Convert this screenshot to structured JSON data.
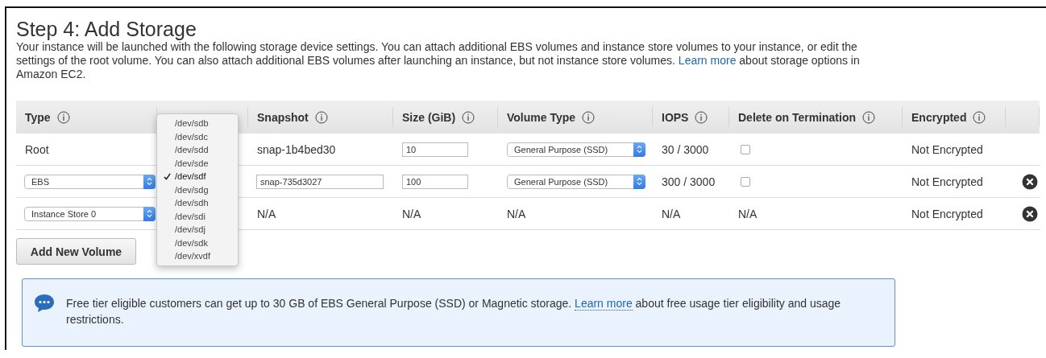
{
  "title": "Step 4: Add Storage",
  "description": {
    "before": "Your instance will be launched with the following storage device settings. You can attach additional EBS volumes and instance store volumes to your instance, or edit the settings of the root volume. You can also attach additional EBS volumes after launching an instance, but not instance store volumes.",
    "link": "Learn more",
    "after": "about storage options in Amazon EC2."
  },
  "table": {
    "columns": [
      "Type",
      "Snapshot",
      "Size (GiB)",
      "Volume Type",
      "IOPS",
      "Delete on Termination",
      "Encrypted"
    ],
    "rows": [
      {
        "type": {
          "kind": "text",
          "value": "Root"
        },
        "snapshot": {
          "kind": "text",
          "value": "snap-1b4bed30"
        },
        "size": {
          "kind": "input",
          "value": "10"
        },
        "volume_type": {
          "kind": "select",
          "value": "General Purpose (SSD)"
        },
        "iops": "30 / 3000",
        "delete_on_termination": {
          "kind": "checkbox",
          "checked": false
        },
        "encrypted": "Not Encrypted",
        "removable": false
      },
      {
        "type": {
          "kind": "select",
          "value": "EBS"
        },
        "snapshot": {
          "kind": "input",
          "value": "snap-735d3027"
        },
        "size": {
          "kind": "input",
          "value": "100"
        },
        "volume_type": {
          "kind": "select",
          "value": "General Purpose (SSD)"
        },
        "iops": "300 / 3000",
        "delete_on_termination": {
          "kind": "checkbox",
          "checked": false
        },
        "encrypted": "Not Encrypted",
        "removable": true
      },
      {
        "type": {
          "kind": "select",
          "value": "Instance Store 0"
        },
        "snapshot": {
          "kind": "text",
          "value": "N/A"
        },
        "size": {
          "kind": "text",
          "value": "N/A"
        },
        "volume_type": {
          "kind": "text",
          "value": "N/A"
        },
        "iops": "N/A",
        "delete_on_termination": {
          "kind": "text",
          "value": "N/A"
        },
        "encrypted": "Not Encrypted",
        "removable": true
      }
    ]
  },
  "device_menu": [
    {
      "label": "/dev/sdb",
      "selected": false
    },
    {
      "label": "/dev/sdc",
      "selected": false
    },
    {
      "label": "/dev/sdd",
      "selected": false
    },
    {
      "label": "/dev/sde",
      "selected": false
    },
    {
      "label": "/dev/sdf",
      "selected": true
    },
    {
      "label": "/dev/sdg",
      "selected": false
    },
    {
      "label": "/dev/sdh",
      "selected": false
    },
    {
      "label": "/dev/sdi",
      "selected": false
    },
    {
      "label": "/dev/sdj",
      "selected": false
    },
    {
      "label": "/dev/sdk",
      "selected": false
    },
    {
      "label": "/dev/xvdf",
      "selected": false
    }
  ],
  "add_button": "Add New Volume",
  "notice": {
    "before": "Free tier eligible customers can get up to 30 GB of EBS General Purpose (SSD) or Magnetic storage.",
    "link": "Learn more",
    "after": "about free usage tier eligibility and usage restrictions."
  }
}
